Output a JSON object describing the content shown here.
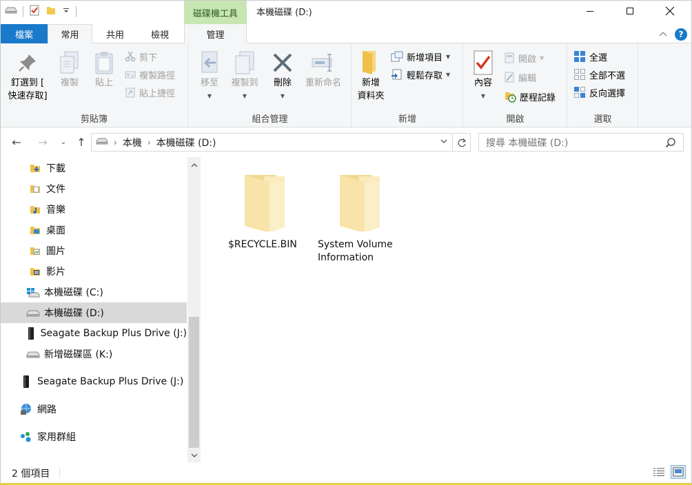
{
  "window": {
    "title": "本機磁碟 (D:)",
    "context_tab_header": "磁碟機工具"
  },
  "tabs": {
    "file": "檔案",
    "home": "常用",
    "share": "共用",
    "view": "檢視",
    "manage": "管理"
  },
  "ribbon": {
    "clipboard": {
      "label": "剪貼簿",
      "pin_line1": "釘選到 [",
      "pin_line2": "快速存取]",
      "copy": "複製",
      "paste": "貼上",
      "cut": "剪下",
      "copy_path": "複製路徑",
      "paste_shortcut": "貼上捷徑"
    },
    "organize": {
      "label": "組合管理",
      "move_to": "移至",
      "copy_to": "複製到",
      "delete": "刪除",
      "rename": "重新命名"
    },
    "new": {
      "label": "新增",
      "new_folder_line1": "新增",
      "new_folder_line2": "資料夾",
      "new_item": "新增項目",
      "easy_access": "輕鬆存取"
    },
    "open": {
      "label": "開啟",
      "properties": "內容",
      "open": "開啟",
      "edit": "編輯",
      "history": "歷程記錄"
    },
    "select": {
      "label": "選取",
      "select_all": "全選",
      "select_none": "全部不選",
      "invert": "反向選擇"
    }
  },
  "address": {
    "crumbs": [
      "本機",
      "本機磁碟 (D:)"
    ],
    "search_placeholder": "搜尋 本機磁碟 (D:)"
  },
  "nav": {
    "items": [
      {
        "label": "下載",
        "icon": "downloads-icon"
      },
      {
        "label": "文件",
        "icon": "documents-icon"
      },
      {
        "label": "音樂",
        "icon": "music-icon"
      },
      {
        "label": "桌面",
        "icon": "desktop-icon"
      },
      {
        "label": "圖片",
        "icon": "pictures-icon"
      },
      {
        "label": "影片",
        "icon": "videos-icon"
      },
      {
        "label": "本機磁碟 (C:)",
        "icon": "windows-drive-icon"
      },
      {
        "label": "本機磁碟 (D:)",
        "icon": "drive-icon",
        "selected": true
      },
      {
        "label": "Seagate Backup Plus Drive (J:)",
        "icon": "external-drive-icon"
      },
      {
        "label": "新增磁碟區 (K:)",
        "icon": "drive-icon"
      },
      {
        "label": "Seagate Backup Plus Drive (J:)",
        "icon": "external-drive-icon"
      },
      {
        "label": "網路",
        "icon": "network-icon"
      },
      {
        "label": "家用群組",
        "icon": "homegroup-icon"
      }
    ]
  },
  "content": {
    "files": [
      {
        "name": "$RECYCLE.BIN",
        "icon": "folder-icon"
      },
      {
        "name": "System Volume Information",
        "icon": "folder-icon"
      }
    ]
  },
  "status": {
    "item_count": "2 個項目"
  },
  "colors": {
    "file_tab": "#1979ca",
    "context_tab": "#c8e6b3",
    "ribbon_bg": "#f5f6f7",
    "selection": "#d9d9d9",
    "folder": "#f8e7b0"
  }
}
